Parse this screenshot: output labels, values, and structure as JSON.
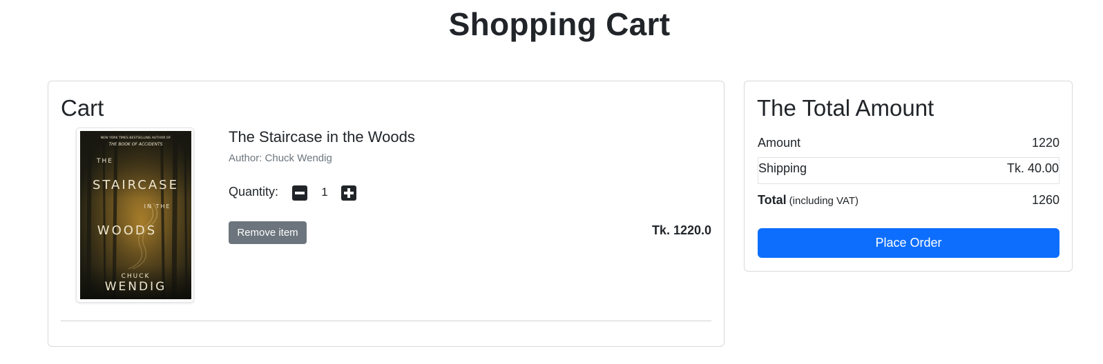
{
  "page": {
    "title": "Shopping Cart"
  },
  "cart": {
    "heading": "Cart",
    "items": [
      {
        "cover": {
          "tagline": "NEW YORK TIMES BESTSELLING AUTHOR OF",
          "previous_book": "THE BOOK OF ACCIDENTS",
          "title_line_1": "THE",
          "title_line_2": "STAIRCASE",
          "title_line_3": "IN THE",
          "title_line_4": "WOODS",
          "author_line_1": "CHUCK",
          "author_line_2": "WENDIG"
        },
        "title": "The Staircase in the Woods",
        "author": "Author: Chuck Wendig",
        "quantity_label": "Quantity:",
        "quantity": "1",
        "remove_label": "Remove item",
        "price": "Tk. 1220.0"
      }
    ]
  },
  "summary": {
    "heading": "The Total Amount",
    "amount_label": "Amount",
    "amount_value": "1220",
    "shipping_label": "Shipping",
    "shipping_value": "Tk. 40.00",
    "total_label": "Total",
    "total_note": "(including VAT)",
    "total_value": "1260",
    "place_order_label": "Place Order"
  },
  "colors": {
    "primary": "#0d6efd",
    "secondary": "#6c757d",
    "text": "#212529"
  },
  "icons": {
    "decrease": "minus-square-icon",
    "increase": "plus-square-icon"
  }
}
